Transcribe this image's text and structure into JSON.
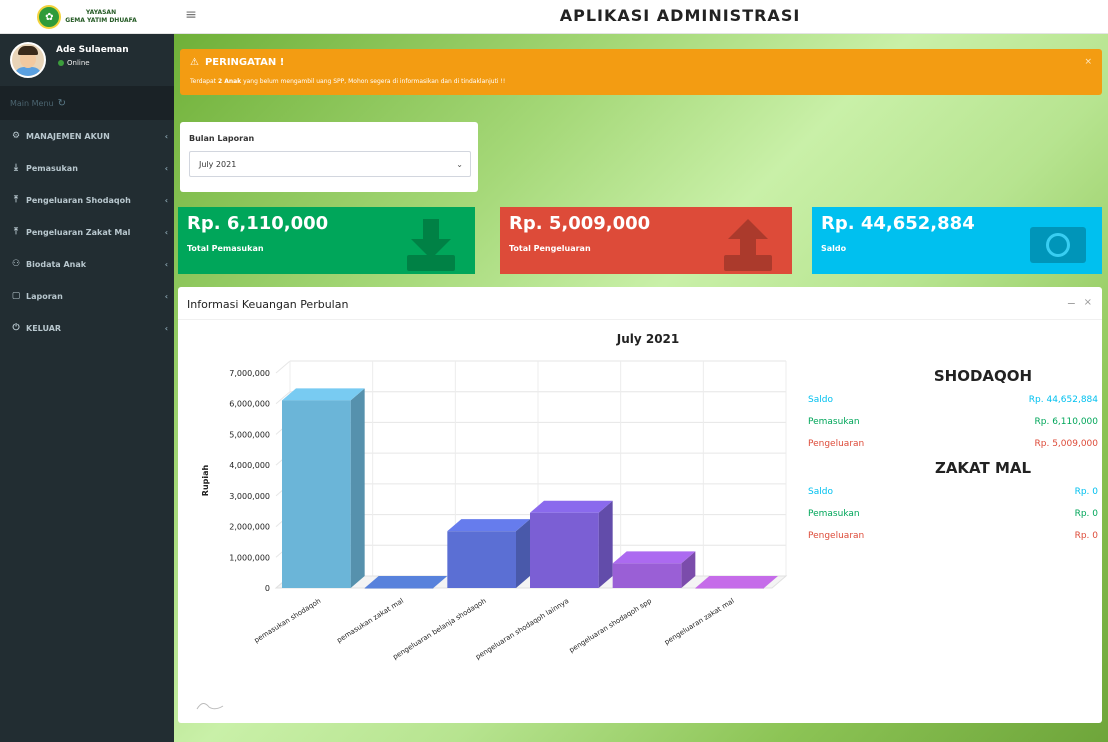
{
  "header": {
    "logo_line1": "YAYASAN",
    "logo_line2": "GEMA YATIM DHUAFA",
    "app_title": "APLIKASI ADMINISTRASI"
  },
  "user": {
    "name": "Ade Sulaeman",
    "status": "Online"
  },
  "menu": {
    "header": "Main Menu",
    "items": [
      {
        "icon": "gear-icon",
        "label": "MANAJEMEN AKUN"
      },
      {
        "icon": "download-icon",
        "label": "Pemasukan"
      },
      {
        "icon": "upload-icon",
        "label": "Pengeluaran Shodaqoh"
      },
      {
        "icon": "upload-icon",
        "label": "Pengeluaran Zakat Mal"
      },
      {
        "icon": "users-icon",
        "label": "Biodata Anak"
      },
      {
        "icon": "file-icon",
        "label": "Laporan"
      },
      {
        "icon": "power-icon",
        "label": "KELUAR"
      }
    ]
  },
  "alert": {
    "title": "PERINGATAN !",
    "message_prefix": "Terdapat ",
    "message_bold": "2 Anak",
    "message_suffix": " yang belum mengambil uang SPP, Mohon segera di informasikan dan di tindaklanjuti !!",
    "close": "×"
  },
  "filter": {
    "label": "Bulan Laporan",
    "selected": "July 2021"
  },
  "stats": {
    "pemasukan": {
      "value": "Rp. 6,110,000",
      "label": "Total Pemasukan"
    },
    "pengeluaran": {
      "value": "Rp. 5,009,000",
      "label": "Total Pengeluaran"
    },
    "saldo": {
      "value": "Rp. 44,652,884",
      "label": "Saldo"
    }
  },
  "box": {
    "title": "Informasi Keuangan Perbulan"
  },
  "chart_data": {
    "type": "bar",
    "title": "July 2021",
    "ylabel": "Rupiah",
    "ylim": [
      0,
      7000000
    ],
    "ytick_labels": [
      "0",
      "1,000,000",
      "2,000,000",
      "3,000,000",
      "4,000,000",
      "5,000,000",
      "6,000,000",
      "7,000,000"
    ],
    "categories": [
      "pemasukan shodaqoh",
      "pemasukan zakat mal",
      "pengeluaran belanja shodaqoh",
      "pengeluaran shodaqoh lainnya",
      "pengeluaran shodaqoh spp",
      "pengeluaran zakat mal"
    ],
    "values": [
      6110000,
      0,
      1850000,
      2450000,
      800000,
      0
    ],
    "colors": [
      "#6bb5d8",
      "#4f74c4",
      "#5b6fd4",
      "#7b5fd4",
      "#9a5fd6",
      "#b060d0"
    ],
    "grid": true
  },
  "summary": {
    "shodaqoh": {
      "title": "SHODAQOH",
      "saldo_label": "Saldo",
      "saldo_value": "Rp. 44,652,884",
      "pemasukan_label": "Pemasukan",
      "pemasukan_value": "Rp. 6,110,000",
      "pengeluaran_label": "Pengeluaran",
      "pengeluaran_value": "Rp. 5,009,000"
    },
    "zakat": {
      "title": "ZAKAT MAL",
      "saldo_label": "Saldo",
      "saldo_value": "Rp. 0",
      "pemasukan_label": "Pemasukan",
      "pemasukan_value": "Rp. 0",
      "pengeluaran_label": "Pengeluaran",
      "pengeluaran_value": "Rp. 0"
    }
  }
}
